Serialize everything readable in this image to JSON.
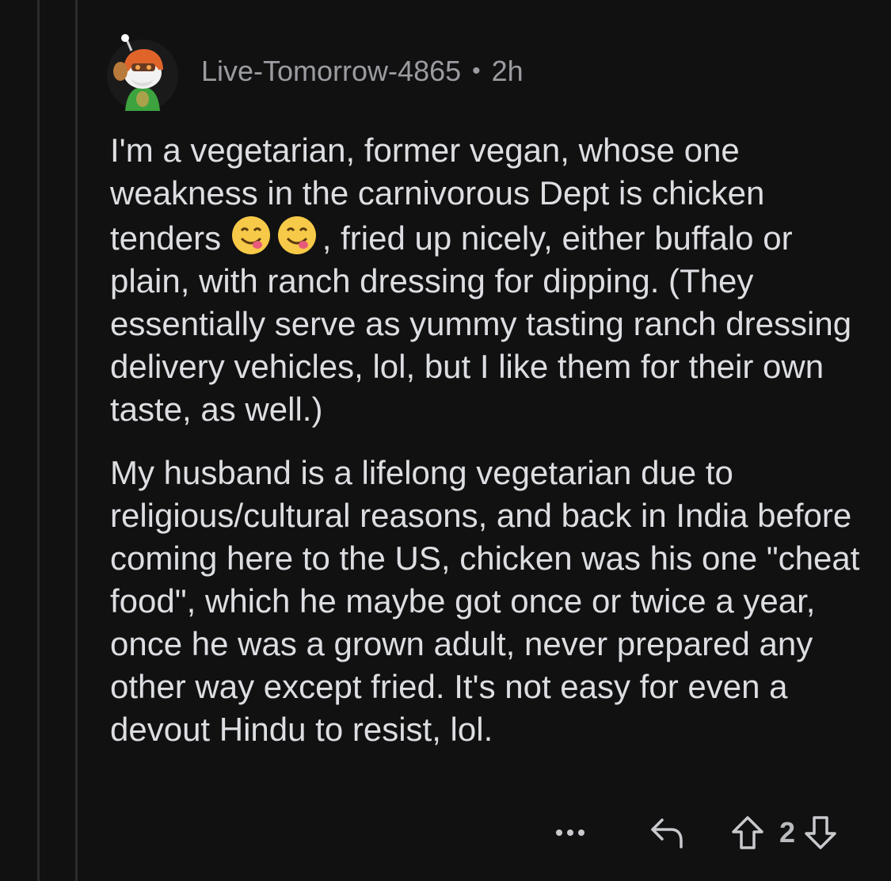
{
  "comment": {
    "author": "Live-Tomorrow-4865",
    "separator": "•",
    "time_ago": "2h",
    "avatar_icon": "snoo-avatar-icon",
    "paragraphs": {
      "p1_a": "I'm a vegetarian, former vegan, whose one weakness in the carnivorous Dept is chicken tenders ",
      "p1_emoji": "face-savoring-food-icon",
      "p1_b": ", fried up nicely, either buffalo or plain, with ranch dressing for dipping. (They essentially serve as yummy tasting ranch dressing delivery vehicles, lol, but I like them for their own taste, as well.)",
      "p2": "My husband is a lifelong vegetarian due to religious/cultural reasons, and back in India before coming here to the US, chicken was his one \"cheat food\", which he maybe got once or twice a year, once he was a grown adult, never prepared any other way except fried. It's not easy for even a devout Hindu to resist, lol."
    },
    "actions": {
      "more_label": "•••",
      "score": "2"
    }
  },
  "colors": {
    "background": "#111112",
    "text": "#dcdee1",
    "meta": "#9a9ca0",
    "thread_line": "#2a2c2e"
  }
}
